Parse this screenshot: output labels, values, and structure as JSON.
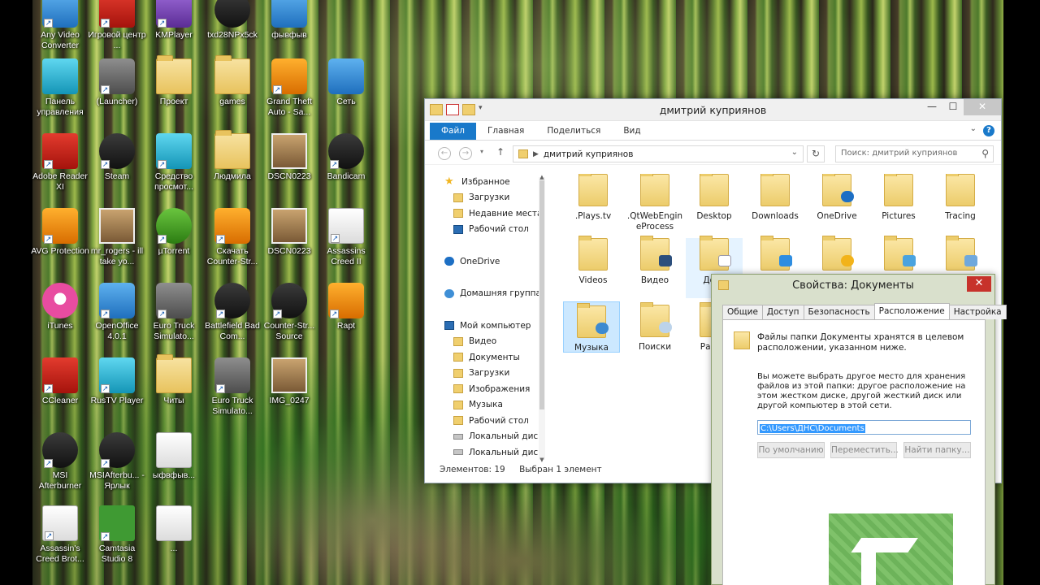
{
  "desktop": {
    "icons": [
      {
        "label": "Any Video Converter"
      },
      {
        "label": "Игровой центр ..."
      },
      {
        "label": "KMPlayer"
      },
      {
        "label": "txd28NPx5ck"
      },
      {
        "label": "фывфыв"
      },
      {
        "label": "Панель управления"
      },
      {
        "label": "(Launcher)"
      },
      {
        "label": "Проект"
      },
      {
        "label": "games"
      },
      {
        "label": "Grand Theft Auto - Sa..."
      },
      {
        "label": "Сеть"
      },
      {
        "label": "Adobe Reader XI"
      },
      {
        "label": "Steam"
      },
      {
        "label": "Средство просмот..."
      },
      {
        "label": "Людмила"
      },
      {
        "label": "DSCN0223"
      },
      {
        "label": "Bandicam"
      },
      {
        "label": "AVG Protection"
      },
      {
        "label": "mr_rogers - ill take yo..."
      },
      {
        "label": "µTorrent"
      },
      {
        "label": "Скачать Counter-Str..."
      },
      {
        "label": "DSCN0223"
      },
      {
        "label": "Assassins Creed II"
      },
      {
        "label": "iTunes"
      },
      {
        "label": "OpenOffice 4.0.1"
      },
      {
        "label": "Euro Truck Simulato..."
      },
      {
        "label": "Battlefield Bad Com..."
      },
      {
        "label": "Counter-Str... Source"
      },
      {
        "label": "Rapt"
      },
      {
        "label": "CCleaner"
      },
      {
        "label": "RusTV Player"
      },
      {
        "label": "Читы"
      },
      {
        "label": "Euro Truck Simulato..."
      },
      {
        "label": "IMG_0247"
      },
      {
        "label": "MSI Afterburner"
      },
      {
        "label": "MSIAfterbu... - Ярлык"
      },
      {
        "label": "ыфвфыв..."
      },
      {
        "label": "Assassin's Creed Brot..."
      },
      {
        "label": "Camtasia Studio 8"
      },
      {
        "label": "..."
      }
    ]
  },
  "explorer": {
    "title": "дмитрий куприянов",
    "ribbon_tabs": [
      "Файл",
      "Главная",
      "Поделиться",
      "Вид"
    ],
    "help": "?",
    "address": "дмитрий куприянов",
    "search_placeholder": "Поиск: дмитрий куприянов",
    "nav": [
      {
        "label": "Избранное"
      },
      {
        "label": "Загрузки"
      },
      {
        "label": "Недавние места"
      },
      {
        "label": "Рабочий стол"
      },
      {
        "label": "OneDrive"
      },
      {
        "label": "Домашняя группа"
      },
      {
        "label": "Мой компьютер"
      },
      {
        "label": "Видео"
      },
      {
        "label": "Документы"
      },
      {
        "label": "Загрузки"
      },
      {
        "label": "Изображения"
      },
      {
        "label": "Музыка"
      },
      {
        "label": "Рабочий стол"
      },
      {
        "label": "Локальный диск"
      },
      {
        "label": "Локальный диск"
      }
    ],
    "files": [
      {
        "label": ".Plays.tv"
      },
      {
        "label": ".QtWebEngineProcess"
      },
      {
        "label": "Desktop"
      },
      {
        "label": "Downloads"
      },
      {
        "label": "OneDrive"
      },
      {
        "label": "Pictures"
      },
      {
        "label": "Tracing"
      },
      {
        "label": "Videos"
      },
      {
        "label": "Видео"
      },
      {
        "label": "Доку"
      },
      {
        "label": ""
      },
      {
        "label": ""
      },
      {
        "label": ""
      },
      {
        "label": ""
      },
      {
        "label": "Музыка"
      },
      {
        "label": "Поиски"
      },
      {
        "label": "Раб ст"
      }
    ],
    "status": {
      "count": "Элементов: 19",
      "selected": "Выбран 1 элемент"
    }
  },
  "props": {
    "title": "Свойства: Документы",
    "close": "✕",
    "tabs": [
      "Общие",
      "Доступ",
      "Безопасность",
      "Расположение",
      "Настройка"
    ],
    "active_tab": "Расположение",
    "intro": "Файлы папки Документы хранятся в целевом расположении, указанном ниже.",
    "hint": "Вы можете выбрать другое место для хранения файлов из этой папки: другое расположение на этом жестком диске, другой жесткий диск или другой компьютер в этой сети.",
    "path": "C:\\Users\\ДНС\\Documents",
    "buttons": [
      "По умолчанию",
      "Переместить...",
      "Найти папку..."
    ]
  }
}
